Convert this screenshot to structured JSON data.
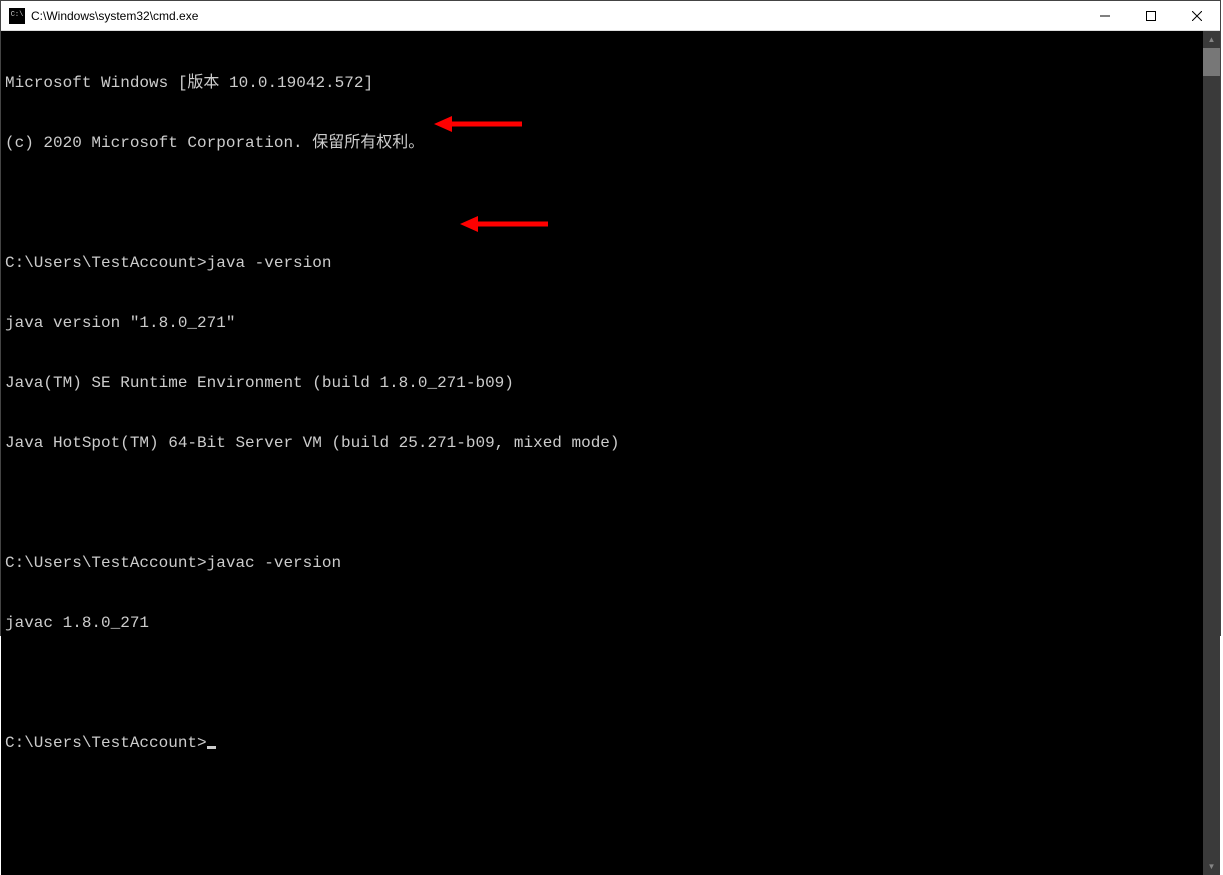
{
  "titlebar": {
    "icon_name": "cmd-icon",
    "title": "C:\\Windows\\system32\\cmd.exe"
  },
  "terminal": {
    "lines": [
      "Microsoft Windows [版本 10.0.19042.572]",
      "(c) 2020 Microsoft Corporation. 保留所有权利。",
      "",
      "C:\\Users\\TestAccount>java -version",
      "java version \"1.8.0_271\"",
      "Java(TM) SE Runtime Environment (build 1.8.0_271-b09)",
      "Java HotSpot(TM) 64-Bit Server VM (build 25.271-b09, mixed mode)",
      "",
      "C:\\Users\\TestAccount>javac -version",
      "javac 1.8.0_271",
      "",
      "C:\\Users\\TestAccount>"
    ],
    "cursor_after_line_index": 11
  },
  "annotations": {
    "arrow_color": "#ff0000",
    "arrows": [
      {
        "points_to": "java -version"
      },
      {
        "points_to": "javac -version"
      }
    ]
  }
}
